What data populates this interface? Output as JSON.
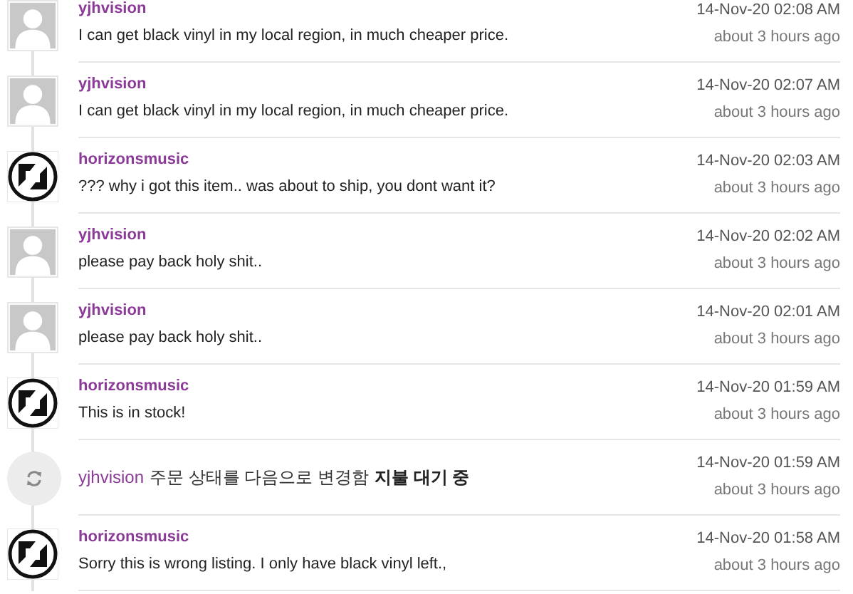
{
  "activity": [
    {
      "kind": "comment",
      "avatar": {
        "kind": "silhouette"
      },
      "user": "yjhvision",
      "message": "I can get black vinyl in my local region, in much cheaper price.",
      "date": "14-Nov-20 02:08 AM",
      "ago": "about 3 hours ago"
    },
    {
      "kind": "comment",
      "avatar": {
        "kind": "silhouette"
      },
      "user": "yjhvision",
      "message": "I can get black vinyl in my local region, in much cheaper price.",
      "date": "14-Nov-20 02:07 AM",
      "ago": "about 3 hours ago"
    },
    {
      "kind": "comment",
      "avatar": {
        "kind": "logo"
      },
      "user": "horizonsmusic",
      "message": "??? why i got this item.. was about to ship, you dont want it?",
      "date": "14-Nov-20 02:03 AM",
      "ago": "about 3 hours ago"
    },
    {
      "kind": "comment",
      "avatar": {
        "kind": "silhouette"
      },
      "user": "yjhvision",
      "message": "please pay back holy shit..",
      "date": "14-Nov-20 02:02 AM",
      "ago": "about 3 hours ago"
    },
    {
      "kind": "comment",
      "avatar": {
        "kind": "silhouette"
      },
      "user": "yjhvision",
      "message": "please pay back holy shit..",
      "date": "14-Nov-20 02:01 AM",
      "ago": "about 3 hours ago"
    },
    {
      "kind": "comment",
      "avatar": {
        "kind": "logo"
      },
      "user": "horizonsmusic",
      "message": "This is in stock!",
      "date": "14-Nov-20 01:59 AM",
      "ago": "about 3 hours ago"
    },
    {
      "kind": "event",
      "user": "yjhvision",
      "action": "주문 상태를 다음으로 변경함",
      "status": "지불 대기 중",
      "date": "14-Nov-20 01:59 AM",
      "ago": "about 3 hours ago"
    },
    {
      "kind": "comment",
      "avatar": {
        "kind": "logo"
      },
      "user": "horizonsmusic",
      "message": "Sorry this is wrong listing. I only have black vinyl left.,",
      "date": "14-Nov-20 01:58 AM",
      "ago": "about 3 hours ago"
    }
  ]
}
